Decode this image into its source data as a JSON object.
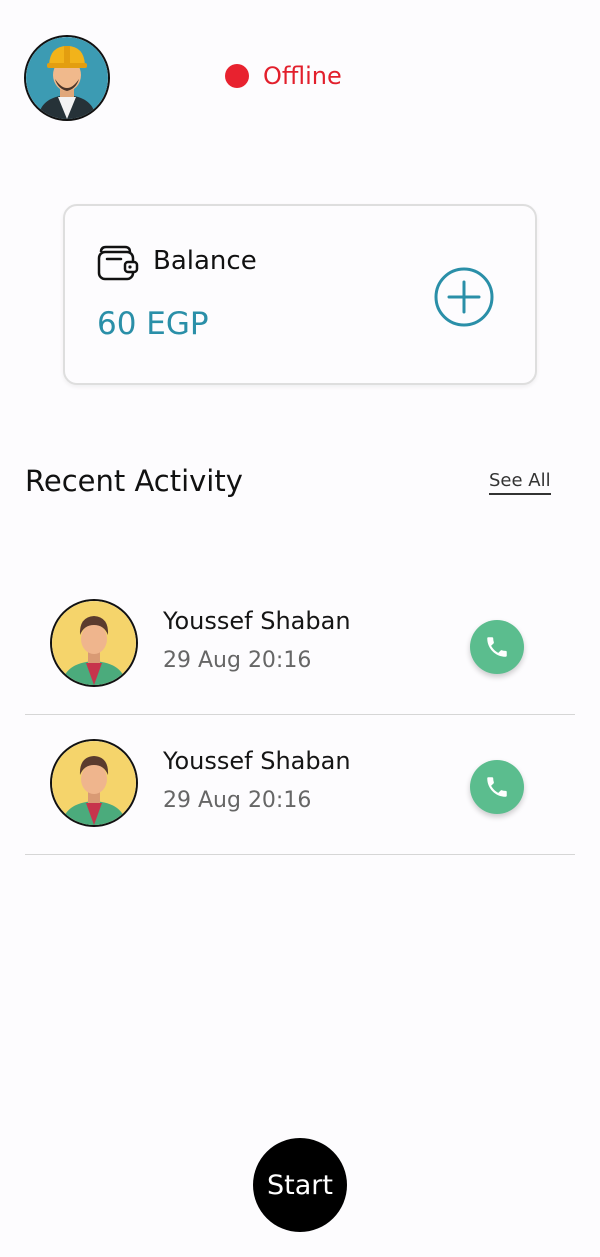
{
  "header": {
    "avatar_icon": "worker-avatar-icon",
    "status_text": "Offline",
    "status_color": "#e8222f"
  },
  "balance": {
    "icon": "wallet-icon",
    "label": "Balance",
    "amount": "60 EGP",
    "add_icon": "plus-circle-icon",
    "accent_color": "#2a8fa8"
  },
  "recent": {
    "title": "Recent Activity",
    "see_all": "See All",
    "items": [
      {
        "name": "Youssef Shaban",
        "time": "29 Aug 20:16",
        "call_icon": "phone-icon"
      },
      {
        "name": "Youssef Shaban",
        "time": "29 Aug 20:16",
        "call_icon": "phone-icon"
      }
    ],
    "call_color": "#5bbd8e"
  },
  "footer": {
    "start_label": "Start"
  }
}
